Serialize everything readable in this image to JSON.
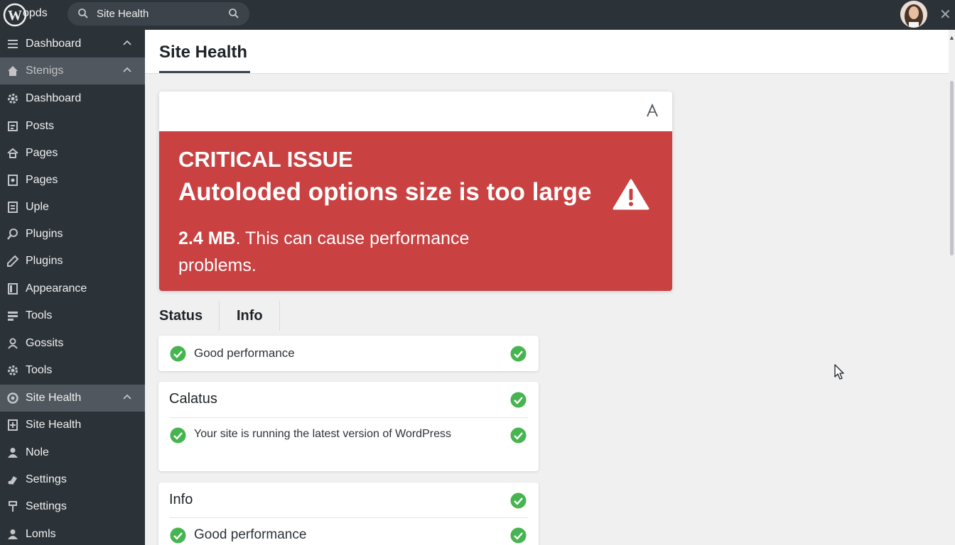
{
  "topbar": {
    "logo_text": "opds",
    "search_text": "Site Health"
  },
  "sidebar": {
    "items": [
      {
        "label": "Dashboard",
        "icon": "menu-icon"
      },
      {
        "label": "Stenigs",
        "icon": "home-icon"
      },
      {
        "label": "Dashboard",
        "icon": "gear-icon"
      },
      {
        "label": "Posts",
        "icon": "posts-icon"
      },
      {
        "label": "Pages",
        "icon": "pages-icon"
      },
      {
        "label": "Pages",
        "icon": "page-icon"
      },
      {
        "label": "Uple",
        "icon": "upload-icon"
      },
      {
        "label": "Plugins",
        "icon": "plugin-icon"
      },
      {
        "label": "Plugins",
        "icon": "pencil-icon"
      },
      {
        "label": "Appearance",
        "icon": "appearance-icon"
      },
      {
        "label": "Tools",
        "icon": "tools-icon"
      },
      {
        "label": "Gossits",
        "icon": "user-icon"
      },
      {
        "label": "Tools",
        "icon": "gear-icon"
      },
      {
        "label": "Site Health",
        "icon": "site-health-icon"
      },
      {
        "label": "Site Health",
        "icon": "health-icon"
      },
      {
        "label": "Nole",
        "icon": "person-icon"
      },
      {
        "label": "Settings",
        "icon": "settings-icon"
      },
      {
        "label": "Settings",
        "icon": "settings-icon"
      },
      {
        "label": "Lomls",
        "icon": "person-icon"
      }
    ]
  },
  "header": {
    "title": "Site Health"
  },
  "alert": {
    "label": "CRITICAL ISSUE",
    "headline": "Autoloded options size is too large",
    "size": "2.4 MB",
    "description": ". This can cause performance problems.",
    "color": "#c94141"
  },
  "tabs": [
    {
      "label": "Status"
    },
    {
      "label": "Info"
    }
  ],
  "cards": {
    "first": {
      "item": "Good performance"
    },
    "second": {
      "title": "Calatus",
      "item": "Your site is running the latest version of WordPress"
    },
    "third": {
      "title": "Info",
      "item": "Good performance"
    }
  },
  "colors": {
    "success": "#46b450",
    "sidebar": "#2c3338"
  }
}
